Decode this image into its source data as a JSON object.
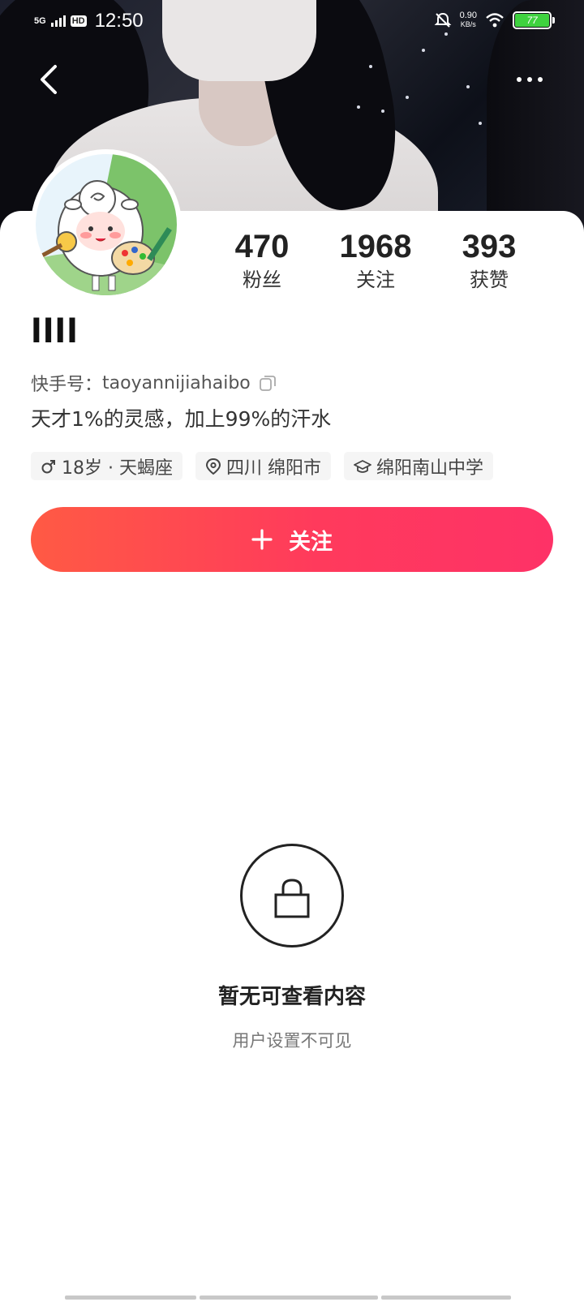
{
  "status_bar": {
    "network": "5G",
    "hd": "HD",
    "time": "12:50",
    "speed_value": "0.90",
    "speed_unit": "KB/s",
    "battery": "77"
  },
  "profile": {
    "nickname": "llll",
    "stats": [
      {
        "number": "470",
        "label": "粉丝"
      },
      {
        "number": "1968",
        "label": "关注"
      },
      {
        "number": "393",
        "label": "获赞"
      }
    ],
    "kuaishou_id_label": "快手号：",
    "kuaishou_id": "taoyannijiahaibo",
    "bio": "天才1%的灵感，加上99%的汗水",
    "tags": {
      "age": "18岁 · 天蝎座",
      "location": "四川 绵阳市",
      "school": "绵阳南山中学"
    }
  },
  "follow_button": {
    "label": "关注"
  },
  "empty_state": {
    "title": "暂无可查看内容",
    "subtitle": "用户设置不可见"
  },
  "colors": {
    "accent_start": "#ff5a44",
    "accent_end": "#fe3267",
    "battery": "#3fd23f"
  }
}
